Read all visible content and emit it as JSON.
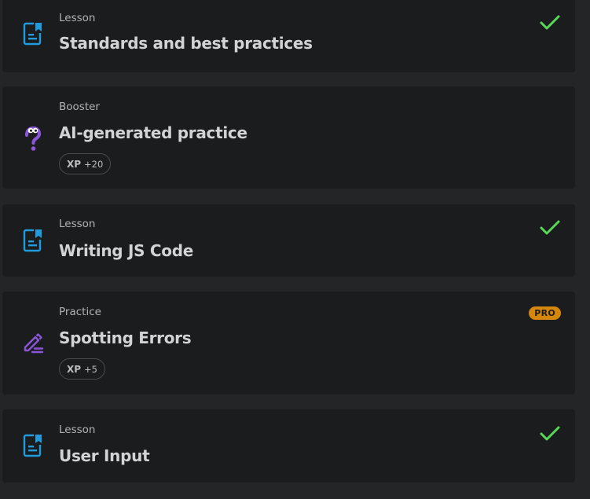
{
  "colors": {
    "lesson_icon": "#1f9bde",
    "purple_icon": "#8a55d8",
    "check": "#57d856",
    "pro": "#d5870b"
  },
  "items": [
    {
      "type": "Lesson",
      "title": "Standards and best practices",
      "icon": "lesson-doc-icon",
      "completed": true
    },
    {
      "type": "Booster",
      "title": "AI-generated practice",
      "icon": "question-mark-icon",
      "xp_label": "XP",
      "xp": "+20"
    },
    {
      "type": "Lesson",
      "title": "Writing JS Code",
      "icon": "lesson-doc-icon",
      "completed": true
    },
    {
      "type": "Practice",
      "title": "Spotting Errors",
      "icon": "pencil-icon",
      "pro": "PRO",
      "xp_label": "XP",
      "xp": "+5"
    },
    {
      "type": "Lesson",
      "title": "User Input",
      "icon": "lesson-doc-icon",
      "completed": true
    }
  ]
}
